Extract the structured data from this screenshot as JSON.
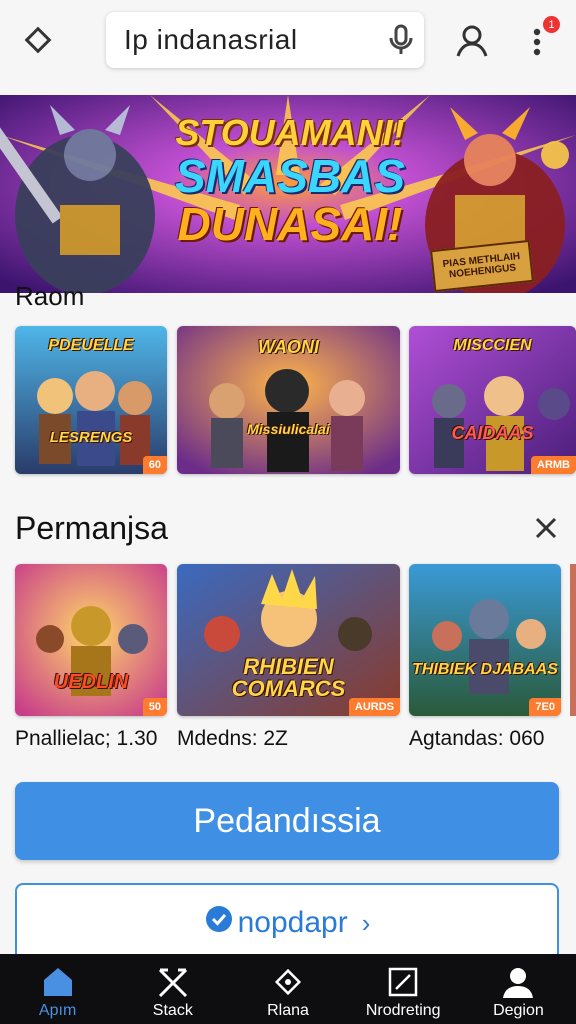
{
  "topbar": {
    "search_text": "Ip indanasrial",
    "notification_count": "1",
    "icons": [
      "diamond-icon",
      "mic-icon",
      "user-icon",
      "more-vert-icon"
    ]
  },
  "hero": {
    "line1": "STOUAMANI!",
    "line2": "SMASBAS",
    "line3": "DUNASAI!",
    "sign": "PIAS METHLAIH NOEHENIGUS"
  },
  "sections": [
    {
      "title": "Raom",
      "cards": [
        {
          "title_top": "PDEUELLE",
          "title_bottom": "LESRENGS",
          "badge": "60"
        },
        {
          "title_top": "WAONI",
          "title_bottom": "Missiulicalai",
          "badge": ""
        },
        {
          "title_top": "MISCCIEN",
          "title_bottom": "CAIDAAS",
          "badge": "ARMB"
        }
      ]
    },
    {
      "title": "Permanjsa",
      "cards": [
        {
          "title_top": "",
          "title_bottom": "UEDLIN",
          "badge": "50",
          "meta": "Pnallielac; 1.30"
        },
        {
          "title_top": "",
          "title_bottom": "RHIBIEN COMARCS",
          "badge": "AURDS",
          "meta": "Mdedns: 2Z"
        },
        {
          "title_top": "",
          "title_bottom": "THIBIEK DJABAAS",
          "badge": "7E0",
          "meta": "Agtandas: 060"
        }
      ]
    }
  ],
  "buttons": {
    "primary": "Pedandıssia",
    "secondary": "nopdapr",
    "secondary_arrow": "›"
  },
  "nav": [
    {
      "label": "Apım",
      "icon": "home-icon",
      "active": true
    },
    {
      "label": "Stack",
      "icon": "swords-icon",
      "active": false
    },
    {
      "label": "Rlana",
      "icon": "diamond-icon",
      "active": false
    },
    {
      "label": "Nrodreting",
      "icon": "edit-icon",
      "active": false
    },
    {
      "label": "Degion",
      "icon": "profile-icon",
      "active": false
    }
  ],
  "colors": {
    "accent": "#3f8fe4",
    "badge_red": "#e33333",
    "nav_bg": "#0e0e10",
    "hero_purple": "#7b2fbf"
  }
}
